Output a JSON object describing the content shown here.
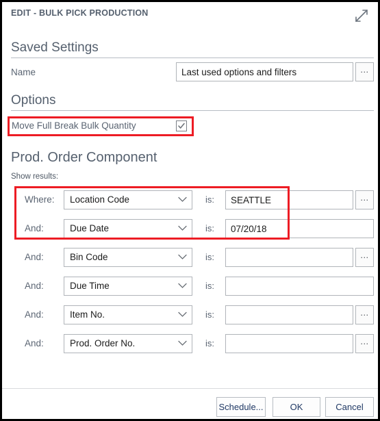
{
  "dialog": {
    "title": "EDIT - BULK PICK PRODUCTION",
    "expand_icon": "expand-diagonal-icon"
  },
  "saved_settings": {
    "header": "Saved Settings",
    "name_label": "Name",
    "name_value": "Last used options and filters",
    "name_placeholder": "",
    "assist_label": "..."
  },
  "options": {
    "header": "Options",
    "checkbox_label": "Move Full Break Bulk Quantity",
    "checkbox_checked": "checked"
  },
  "filters": {
    "header": "Prod. Order Component",
    "show_results_label": "Show results:",
    "rows": [
      {
        "conjunction": "Where:",
        "field": "Location Code",
        "operator": "is:",
        "value": "SEATTLE",
        "has_assist": true,
        "assist_label": "...",
        "highlighted": true
      },
      {
        "conjunction": "And:",
        "field": "Due Date",
        "operator": "is:",
        "value": "07/20/18",
        "has_assist": false,
        "assist_label": "",
        "highlighted": true
      },
      {
        "conjunction": "And:",
        "field": "Bin Code",
        "operator": "is:",
        "value": "",
        "has_assist": true,
        "assist_label": "...",
        "highlighted": false
      },
      {
        "conjunction": "And:",
        "field": "Due Time",
        "operator": "is:",
        "value": "",
        "has_assist": false,
        "assist_label": "",
        "highlighted": false
      },
      {
        "conjunction": "And:",
        "field": "Item No.",
        "operator": "is:",
        "value": "",
        "has_assist": true,
        "assist_label": "...",
        "highlighted": false
      },
      {
        "conjunction": "And:",
        "field": "Prod. Order No.",
        "operator": "is:",
        "value": "",
        "has_assist": true,
        "assist_label": "...",
        "highlighted": false
      }
    ]
  },
  "footer": {
    "schedule_label": "Schedule...",
    "ok_label": "OK",
    "cancel_label": "Cancel"
  },
  "colors": {
    "annotation_red": "#ed1c24",
    "header_slate": "#55606e",
    "button_text_navy": "#1f3864",
    "border_gray": "#b0b4b9"
  }
}
